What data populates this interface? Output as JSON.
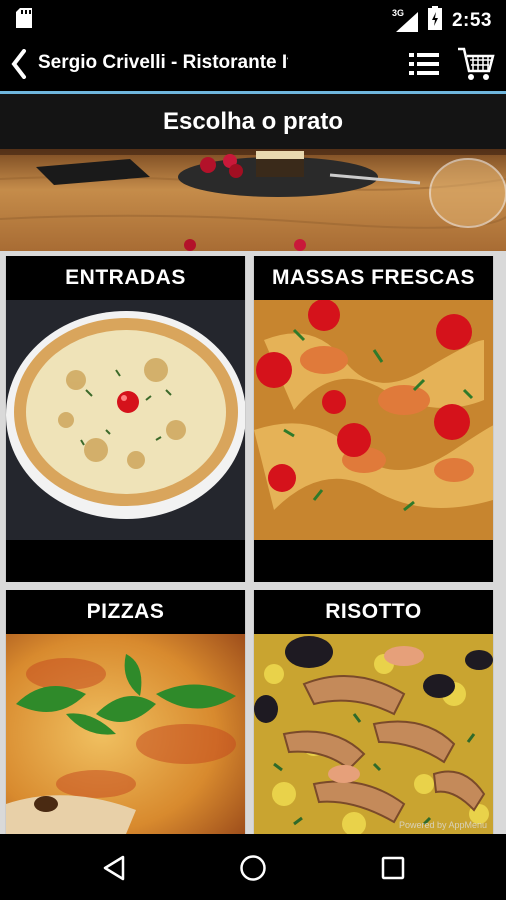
{
  "status_bar": {
    "time": "2:53",
    "network": "3G",
    "icons": [
      "sd-card-icon",
      "signal-icon",
      "battery-icon"
    ]
  },
  "app_bar": {
    "title": "Sergio Crivelli - Ristorante It...",
    "icons": [
      "back-chevron-icon",
      "list-icon",
      "cart-icon"
    ]
  },
  "section_header": {
    "title": "Escolha o prato"
  },
  "categories": [
    {
      "label": "ENTRADAS"
    },
    {
      "label": "MASSAS FRESCAS"
    },
    {
      "label": "PIZZAS"
    },
    {
      "label": "RISOTTO"
    }
  ],
  "watermark": "Powered by AppMenu",
  "nav_bar": {
    "icons": [
      "back-triangle-icon",
      "home-circle-icon",
      "recents-square-icon"
    ]
  },
  "colors": {
    "accent": "#6fb6dd",
    "header": "#141414",
    "background": "#000000"
  }
}
